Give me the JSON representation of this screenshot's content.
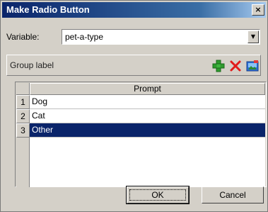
{
  "window": {
    "title": "Make Radio Button",
    "close_glyph": "×"
  },
  "variable": {
    "label": "Variable:",
    "value": "pet-a-type"
  },
  "group": {
    "label": "Group label"
  },
  "toolbar_icons": [
    "add-icon",
    "delete-icon",
    "image-icon"
  ],
  "grid": {
    "column_header": "Prompt",
    "rows": [
      {
        "num": "1",
        "prompt": "Dog"
      },
      {
        "num": "2",
        "prompt": "Cat"
      },
      {
        "num": "3",
        "prompt": "Other"
      }
    ],
    "selected_row": 3
  },
  "buttons": {
    "ok": "OK",
    "cancel": "Cancel"
  },
  "colors": {
    "title_bar": "#0a246a",
    "selection": "#0a246a",
    "add": "#2e9b2e",
    "delete": "#e21b1b"
  }
}
